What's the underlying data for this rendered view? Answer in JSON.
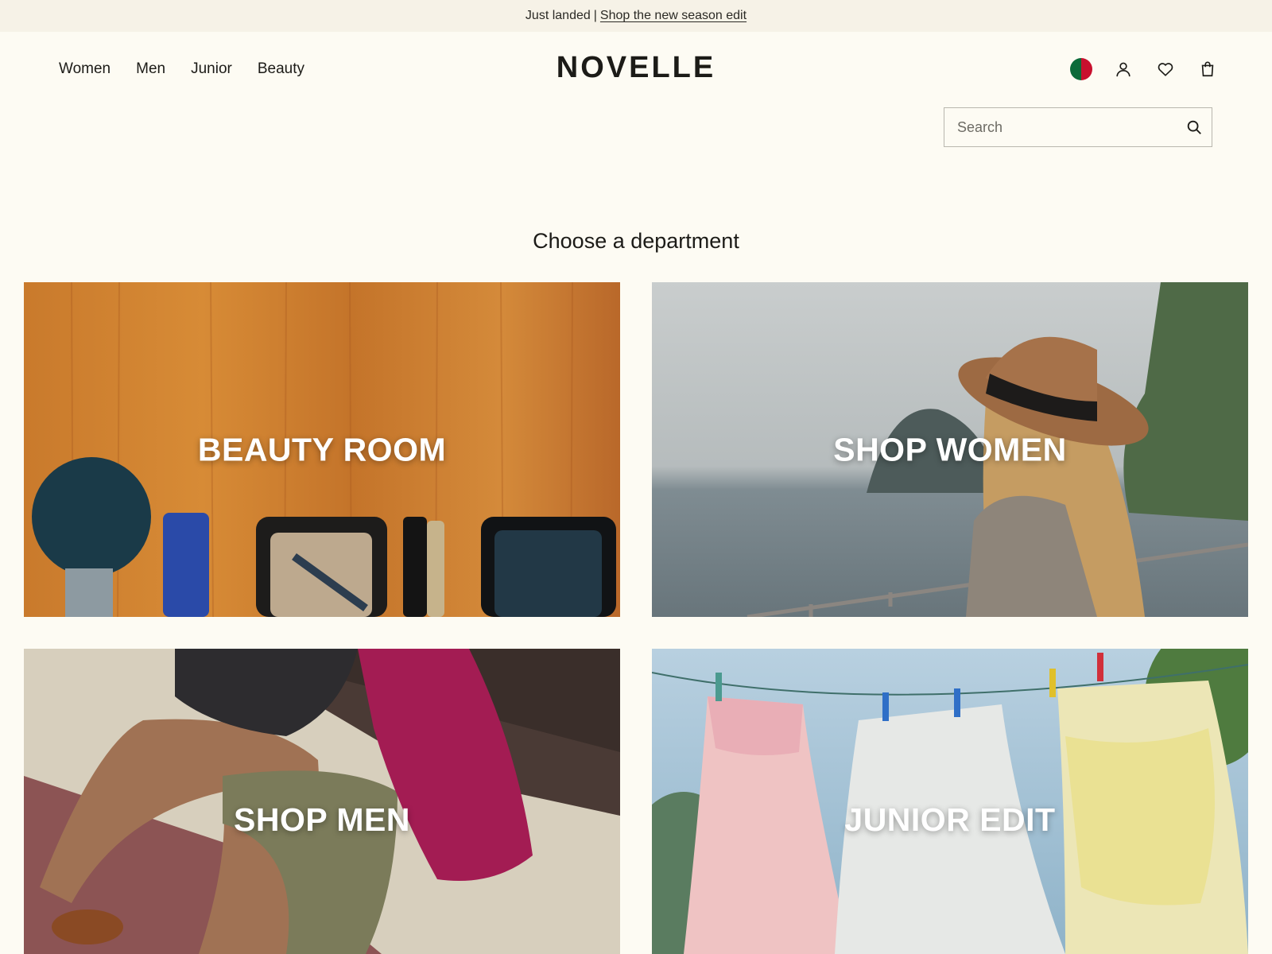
{
  "announcement": {
    "prefix": "Just landed",
    "separator": "|",
    "link": "Shop the new season edit"
  },
  "nav": {
    "items": [
      "Women",
      "Men",
      "Junior",
      "Beauty"
    ]
  },
  "brand": {
    "logo": "NOVELLE"
  },
  "header_icons": [
    "flag-icon",
    "account-icon",
    "wishlist-heart-icon",
    "shopping-bag-icon"
  ],
  "search": {
    "placeholder": "Search",
    "value": ""
  },
  "main": {
    "heading": "Choose a department",
    "tiles": [
      {
        "label": "BEAUTY ROOM"
      },
      {
        "label": "SHOP WOMEN"
      },
      {
        "label": "SHOP MEN"
      },
      {
        "label": "JUNIOR EDIT"
      }
    ]
  },
  "colors": {
    "page_background": "#fdfbf3",
    "announcement_background": "#f6f2e7",
    "text": "#1c1b17"
  }
}
